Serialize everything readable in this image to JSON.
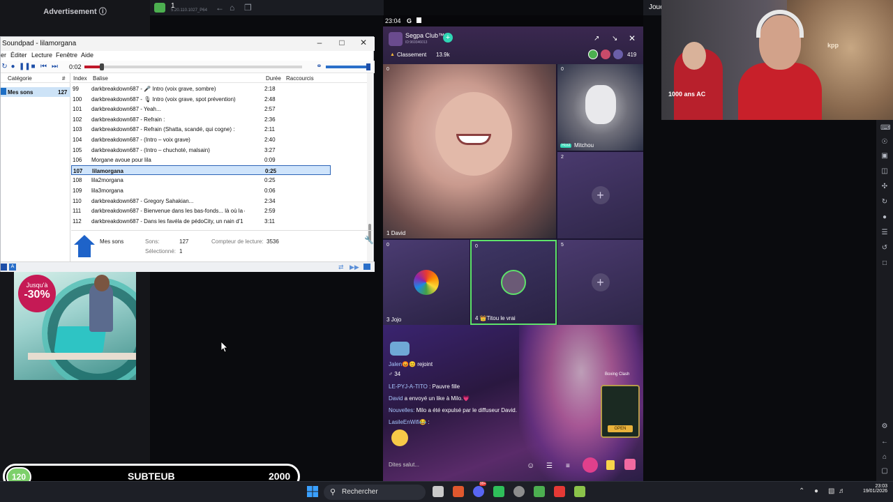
{
  "ad": {
    "label": "Advertisement ⓘ",
    "badge_small": "Jusqu'à",
    "badge_big": "-30%"
  },
  "browser": {
    "tab_title": "1",
    "tab_sub": "5.20.110.1027_P64"
  },
  "right_top_label": "Joue",
  "soundpad": {
    "title": "Soundpad - lilamorgana",
    "menu": [
      "er",
      "Éditer",
      "Lecture",
      "Fenêtre",
      "Aide"
    ],
    "time": "0:02",
    "progress": 0.08,
    "volume": 1.0,
    "sidebar": {
      "header_category": "Catégorie",
      "header_count": "#",
      "item_label": "Mes sons",
      "item_count": "127"
    },
    "columns": [
      "Index",
      "Balise",
      "Durée",
      "Raccourcis"
    ],
    "rows": [
      {
        "index": "99",
        "tag": "darkbreakdown687 - 🎤 Intro (voix grave, sombre)",
        "duration": "2:18"
      },
      {
        "index": "100",
        "tag": "darkbreakdown687 - 🎙 Intro (voix grave, spot prévention)",
        "duration": "2:48"
      },
      {
        "index": "101",
        "tag": "darkbreakdown687 - Yeah...",
        "duration": "2:57"
      },
      {
        "index": "102",
        "tag": "darkbreakdown687 - Refrain :",
        "duration": "2:36"
      },
      {
        "index": "103",
        "tag": "darkbreakdown687 - Refrain (Shatta, scandé, qui cogne) :",
        "duration": "2:11"
      },
      {
        "index": "104",
        "tag": "darkbreakdown687 - (Intro – voix grave)",
        "duration": "2:40"
      },
      {
        "index": "105",
        "tag": "darkbreakdown687 - (Intro – chuchoté, malsain)",
        "duration": "3:27"
      },
      {
        "index": "106",
        "tag": "Morgane avoue pour lila",
        "duration": "0:09"
      },
      {
        "index": "107",
        "tag": "lilamorgana",
        "duration": "0:25",
        "selected": true
      },
      {
        "index": "108",
        "tag": "lila2morgana",
        "duration": "0:25"
      },
      {
        "index": "109",
        "tag": "lila3morgana",
        "duration": "0:06"
      },
      {
        "index": "110",
        "tag": "darkbreakdown687 - Gregory Sahakian...",
        "duration": "2:34"
      },
      {
        "index": "111",
        "tag": "darkbreakdown687 - Bienvenue dans les bas-fonds... là où la c",
        "duration": "2:59"
      },
      {
        "index": "112",
        "tag": "darkbreakdown687 - Dans les favéla de pédoCity, un nain d'1",
        "duration": "3:11"
      }
    ],
    "footer": {
      "folder_name": "Mes sons",
      "sons_label": "Sons:",
      "sons_value": "127",
      "counter_label": "Compteur de lecture:",
      "counter_value": "3536",
      "selected_label": "Sélectionné:",
      "selected_value": "1"
    }
  },
  "phone": {
    "status_time": "23:04",
    "status_icons": "G",
    "club_name": "Segpa Club™",
    "club_id": "ID:969346013",
    "classement": "Classement",
    "points": "13.9k",
    "viewers": "419",
    "tiles": [
      {
        "num": "1",
        "name": "David",
        "count": "0",
        "kind": "video"
      },
      {
        "num": "",
        "name": "Mitchou",
        "count": "0",
        "kind": "cat",
        "host": "Host"
      },
      {
        "num": "2",
        "name": "",
        "count": "",
        "kind": "empty"
      },
      {
        "num": "3",
        "name": "Jojo",
        "count": "0",
        "kind": "avatar"
      },
      {
        "num": "4",
        "name": "👑Titou le vrai",
        "count": "0",
        "kind": "avatar-active"
      },
      {
        "num": "5",
        "name": "",
        "count": "",
        "kind": "empty"
      }
    ],
    "chat": [
      {
        "user": "Jalen😡😊",
        "text": " rejoint"
      },
      {
        "user": "",
        "text": "♂ 34"
      },
      {
        "user": "LE-PYJ-A-TITO",
        "text": " : Pauvre fille"
      },
      {
        "user": "David",
        "text": " a envoyé un like à Milo.💗"
      },
      {
        "user": "Nouvelles:",
        "text": " Milo a été expulsé par le diffuseur David."
      },
      {
        "user": "LasileEnWifi😂",
        "text": " :"
      }
    ],
    "input_placeholder": "Dites salut...",
    "game_label": "Boxing Clash",
    "game_btn": "OPEN"
  },
  "cam": {
    "shirt_text": "1000 ans AC",
    "sign_text": "kpp"
  },
  "goal": {
    "current": "120",
    "label": "SUBTEUB",
    "target": "2000"
  },
  "taskbar": {
    "search": "Rechercher",
    "time": "23:03",
    "date": "19/01/2026",
    "badge": "99+"
  }
}
